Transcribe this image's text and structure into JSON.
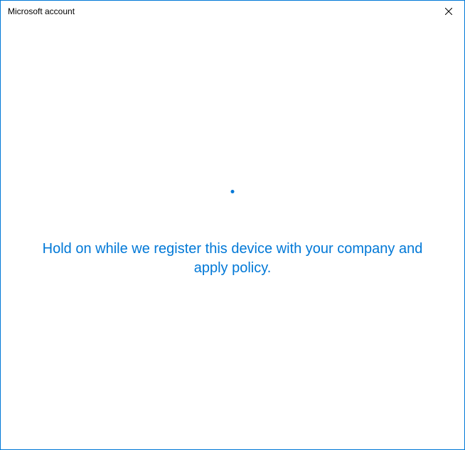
{
  "window": {
    "title": "Microsoft account"
  },
  "content": {
    "status_message": "Hold on while we register this device with your company and apply policy."
  },
  "colors": {
    "accent": "#0078d7",
    "border": "#0078d7"
  }
}
